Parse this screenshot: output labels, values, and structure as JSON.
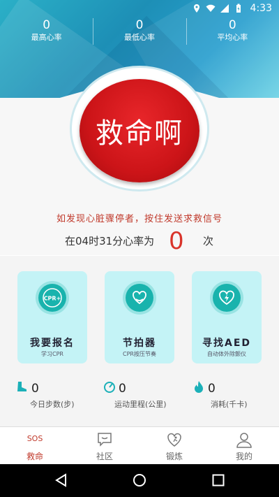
{
  "status_bar": {
    "time": "4:33"
  },
  "stats": [
    {
      "value": "0",
      "label": "最高心率"
    },
    {
      "value": "0",
      "label": "最低心率"
    },
    {
      "value": "0",
      "label": "平均心率"
    }
  ],
  "sos_button": {
    "label": "救命啊"
  },
  "tip": "如发现心脏骤停者，按住发送求救信号",
  "heart_rate": {
    "prefix": "在04时31分心率为",
    "value": "0",
    "unit": "次"
  },
  "cards": [
    {
      "title": "我要报名",
      "subtitle": "学习CPR",
      "icon": "cpr-plus-icon",
      "icon_text": "CPR+"
    },
    {
      "title": "节拍器",
      "subtitle": "CPR按压节奏",
      "icon": "heart-hands-icon"
    },
    {
      "title": "寻找AED",
      "subtitle": "自动体外除颤仪",
      "icon": "heart-bolt-icon"
    }
  ],
  "metrics": [
    {
      "value": "0",
      "label": "今日步数(步)",
      "icon": "shoe-icon"
    },
    {
      "value": "0",
      "label": "运动里程(公里)",
      "icon": "speedometer-icon"
    },
    {
      "value": "0",
      "label": "消耗(千卡)",
      "icon": "flame-icon"
    }
  ],
  "tabs": [
    {
      "label": "救命",
      "badge": "SOS",
      "icon": "sos-icon",
      "active": true
    },
    {
      "label": "社区",
      "icon": "chat-icon"
    },
    {
      "label": "锻炼",
      "icon": "heart-run-icon"
    },
    {
      "label": "我的",
      "icon": "person-icon"
    }
  ],
  "colors": {
    "header_teal": "#2bb0c7",
    "sos_red": "#cc1418",
    "card_bg": "#c4f3f6",
    "card_icon": "#19b3ad",
    "accent_red": "#c0392b"
  }
}
